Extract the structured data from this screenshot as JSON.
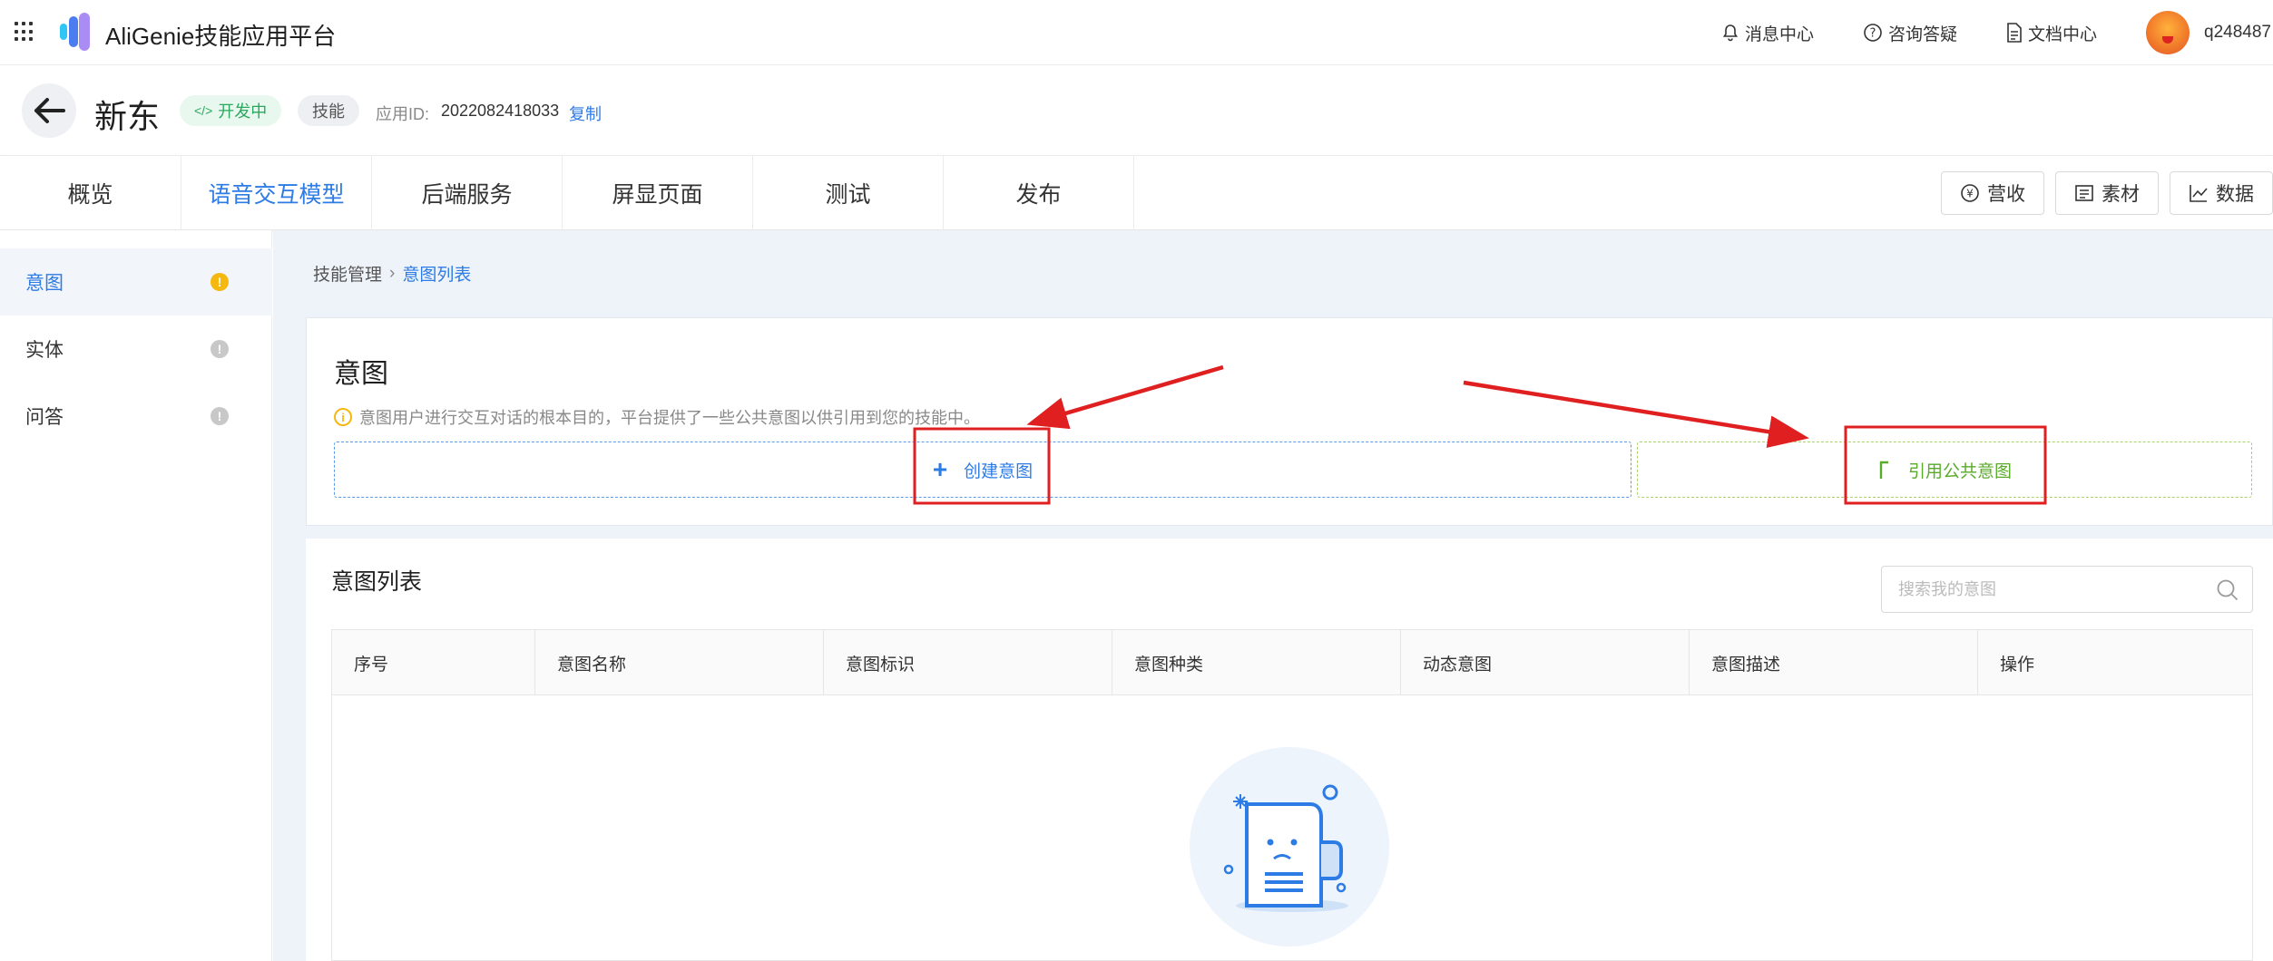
{
  "topbar": {
    "app_title": "AliGenie技能应用平台",
    "links": [
      {
        "label": "消息中心",
        "icon": "bell-icon"
      },
      {
        "label": "咨询答疑",
        "icon": "question-icon"
      },
      {
        "label": "文档中心",
        "icon": "document-icon"
      }
    ],
    "username": "q248487"
  },
  "app_header": {
    "name": "新东",
    "status_badge": "开发中",
    "type_badge": "技能",
    "appid_label": "应用ID:",
    "appid_value": "2022082418033",
    "copy_label": "复制"
  },
  "nav": {
    "tabs": [
      {
        "label": "概览",
        "active": false
      },
      {
        "label": "语音交互模型",
        "active": true
      },
      {
        "label": "后端服务",
        "active": false
      },
      {
        "label": "屏显页面",
        "active": false
      },
      {
        "label": "测试",
        "active": false
      },
      {
        "label": "发布",
        "active": false
      }
    ],
    "actions": [
      {
        "label": "营收",
        "icon": "yen-icon"
      },
      {
        "label": "素材",
        "icon": "material-icon"
      },
      {
        "label": "数据",
        "icon": "chart-icon"
      }
    ]
  },
  "sidebar": {
    "items": [
      {
        "label": "意图",
        "active": true,
        "dot": "warn"
      },
      {
        "label": "实体",
        "active": false,
        "dot": "info"
      },
      {
        "label": "问答",
        "active": false,
        "dot": "info"
      }
    ]
  },
  "breadcrumb": {
    "parent": "技能管理",
    "current": "意图列表"
  },
  "intent_card": {
    "title": "意图",
    "tip": "意图用户进行交互对话的根本目的，平台提供了一些公共意图以供引用到您的技能中。",
    "create_label": "创建意图",
    "reference_label": "引用公共意图"
  },
  "intent_list": {
    "title": "意图列表",
    "search_placeholder": "搜索我的意图",
    "columns": [
      "序号",
      "意图名称",
      "意图标识",
      "意图种类",
      "动态意图",
      "意图描述",
      "操作"
    ]
  },
  "colors": {
    "primary": "#2d7be5",
    "success": "#5aab2a",
    "warning": "#f5b80f",
    "annotation": "#e02020"
  }
}
